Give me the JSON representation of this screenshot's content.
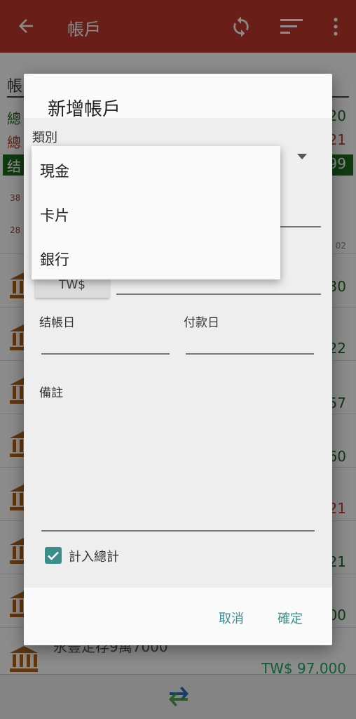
{
  "appbar": {
    "title": "帳戶",
    "color": "#c0392b",
    "icons": [
      "back-arrow-icon",
      "refresh-icon",
      "sort-icon",
      "more-vert-icon"
    ]
  },
  "background": {
    "summary_heading": "帳",
    "summary_rows": [
      {
        "label": "總",
        "value": "20"
      },
      {
        "label": "總",
        "value": "21"
      },
      {
        "label": "结",
        "value": "99"
      }
    ],
    "small_values": [
      "38",
      "28",
      "02"
    ],
    "account_amounts": [
      "30",
      "22",
      "57",
      "60",
      "21",
      "21",
      "00"
    ],
    "last_account_name": "永豐定存9萬7000",
    "last_account_amount": "TW$ 97,000"
  },
  "dialog": {
    "title": "新增帳戶",
    "category_label": "類別",
    "category_options": [
      "現金",
      "卡片",
      "銀行"
    ],
    "currency": "TW$",
    "closing_day_label": "结帳日",
    "payment_day_label": "付款日",
    "note_label": "備註",
    "include_total_label": "計入總計",
    "include_total_checked": true,
    "cancel_label": "取消",
    "confirm_label": "確定",
    "accent_color": "#3a8f8a"
  }
}
